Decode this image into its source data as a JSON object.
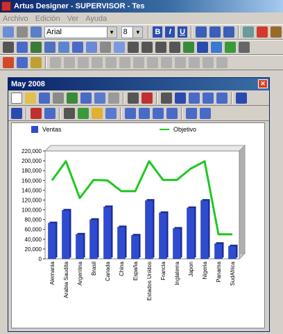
{
  "app": {
    "title": "Artus Designer - SUPERVISOR - Tes"
  },
  "menu": [
    "Archivo",
    "Edición",
    "Ver",
    "Ayuda"
  ],
  "format_toolbar": {
    "font": "Arial",
    "size": "8",
    "bold": "B",
    "italic": "I",
    "underline": "U"
  },
  "document": {
    "title": "May 2008"
  },
  "colors": {
    "bar": "#2f4cd0",
    "line": "#1ec81e",
    "title_bar": "#0a246a"
  },
  "chart_data": {
    "type": "bar",
    "categories": [
      "Alemania",
      "Arabia Saudita",
      "Argentina",
      "Brasil",
      "Canada",
      "China",
      "España",
      "Estados Unidos",
      "Francia",
      "Inglaterra",
      "Japon",
      "Nigeria",
      "Panama",
      "SudAfrica"
    ],
    "series": [
      {
        "name": "Ventas",
        "type": "bar",
        "values": [
          73000,
          99000,
          50000,
          80000,
          106000,
          65000,
          48000,
          119000,
          94000,
          62000,
          104000,
          119000,
          31000,
          26000
        ]
      },
      {
        "name": "Objetivo",
        "type": "line",
        "values": [
          160000,
          199000,
          124000,
          161000,
          160000,
          138000,
          138000,
          199000,
          161000,
          161000,
          184000,
          199000,
          50000,
          50000
        ]
      }
    ],
    "y_ticks": [
      "0",
      "20,000",
      "40,000",
      "60,000",
      "80,000",
      "100,000",
      "120,000",
      "140,000",
      "160,000",
      "180,000",
      "200,000",
      "220,000"
    ],
    "ylim": [
      0,
      220000
    ],
    "grid": false,
    "legend_position": "top"
  }
}
